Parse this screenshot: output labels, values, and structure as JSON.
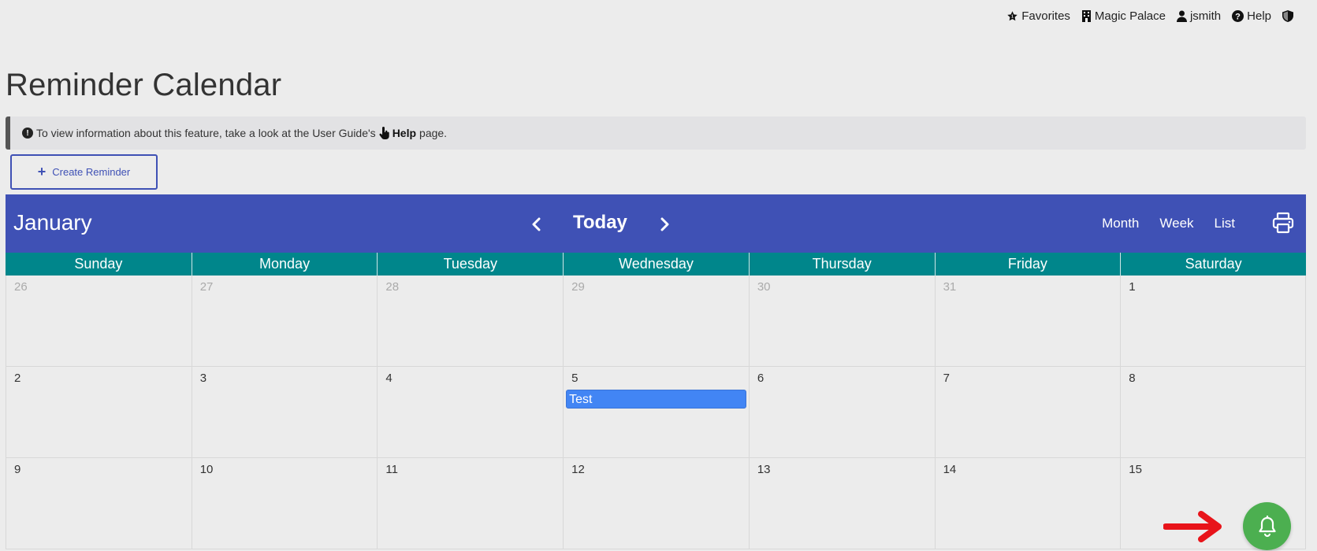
{
  "topnav": {
    "favorites": "Favorites",
    "property": "Magic Palace",
    "user": "jsmith",
    "help": "Help"
  },
  "page": {
    "title": "Reminder Calendar"
  },
  "banner": {
    "text_before": "To view information about this feature, take a look at the User Guide's",
    "link": "Help",
    "text_after": "page."
  },
  "actions": {
    "create_label": "Create Reminder"
  },
  "calendar": {
    "month": "January",
    "today_label": "Today",
    "views": [
      "Month",
      "Week",
      "List"
    ],
    "weekdays": [
      "Sunday",
      "Monday",
      "Tuesday",
      "Wednesday",
      "Thursday",
      "Friday",
      "Saturday"
    ],
    "weeks": [
      [
        {
          "d": "26",
          "muted": true
        },
        {
          "d": "27",
          "muted": true
        },
        {
          "d": "28",
          "muted": true
        },
        {
          "d": "29",
          "muted": true
        },
        {
          "d": "30",
          "muted": true
        },
        {
          "d": "31",
          "muted": true
        },
        {
          "d": "1"
        }
      ],
      [
        {
          "d": "2"
        },
        {
          "d": "3"
        },
        {
          "d": "4"
        },
        {
          "d": "5",
          "event": "Test"
        },
        {
          "d": "6"
        },
        {
          "d": "7"
        },
        {
          "d": "8"
        }
      ],
      [
        {
          "d": "9"
        },
        {
          "d": "10"
        },
        {
          "d": "11"
        },
        {
          "d": "12"
        },
        {
          "d": "13"
        },
        {
          "d": "14"
        },
        {
          "d": "15"
        }
      ]
    ]
  },
  "colors": {
    "header": "#3f51b5",
    "weekday_bar": "#00868b",
    "event": "#4285f4",
    "fab": "#4caf50",
    "annotation_arrow": "#e8141a"
  },
  "icons": {
    "favorites": "star-icon",
    "property": "building-icon",
    "user": "user-icon",
    "help": "question-circle-icon",
    "shield": "shield-icon",
    "print": "printer-icon",
    "fab": "bell-icon"
  }
}
